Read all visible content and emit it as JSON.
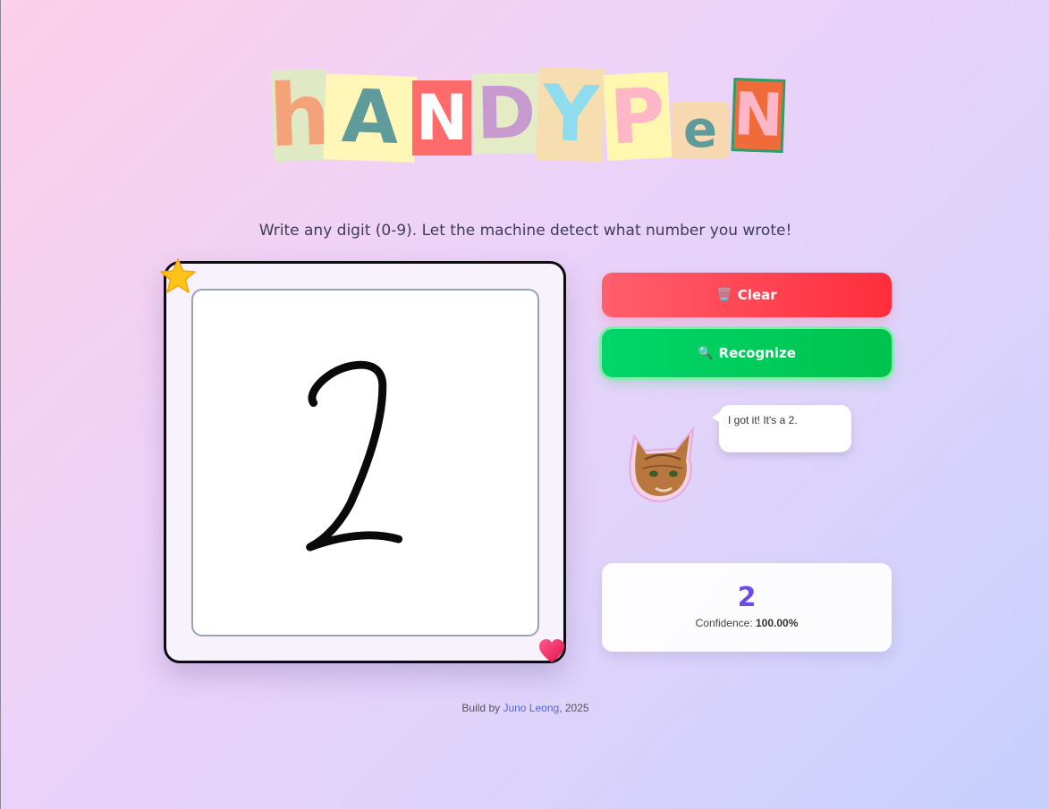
{
  "logo": {
    "letters": [
      "h",
      "A",
      "N",
      "D",
      "Y",
      "P",
      "e",
      "N"
    ]
  },
  "tagline": "Write any digit (0-9). Let the machine detect what number you wrote!",
  "buttons": {
    "clear_icon": "🗑️",
    "clear_label": "Clear",
    "recognize_icon": "🔍",
    "recognize_label": "Recognize"
  },
  "cat": {
    "speech": "I got it! It's a 2."
  },
  "result": {
    "digit": "2",
    "confidence_label": "Confidence:",
    "confidence_value": "100.00%"
  },
  "footer": {
    "prefix": "Build by",
    "author": "Juno Leong",
    "suffix": ", 2025"
  },
  "icons": {
    "decoration_top_left": "star-icon",
    "decoration_bottom_right": "heart-icon"
  },
  "colors": {
    "clear": "#ff3b48",
    "recognize": "#00cc5a",
    "result_digit": "#6c4ce6",
    "link": "#5566d8"
  }
}
